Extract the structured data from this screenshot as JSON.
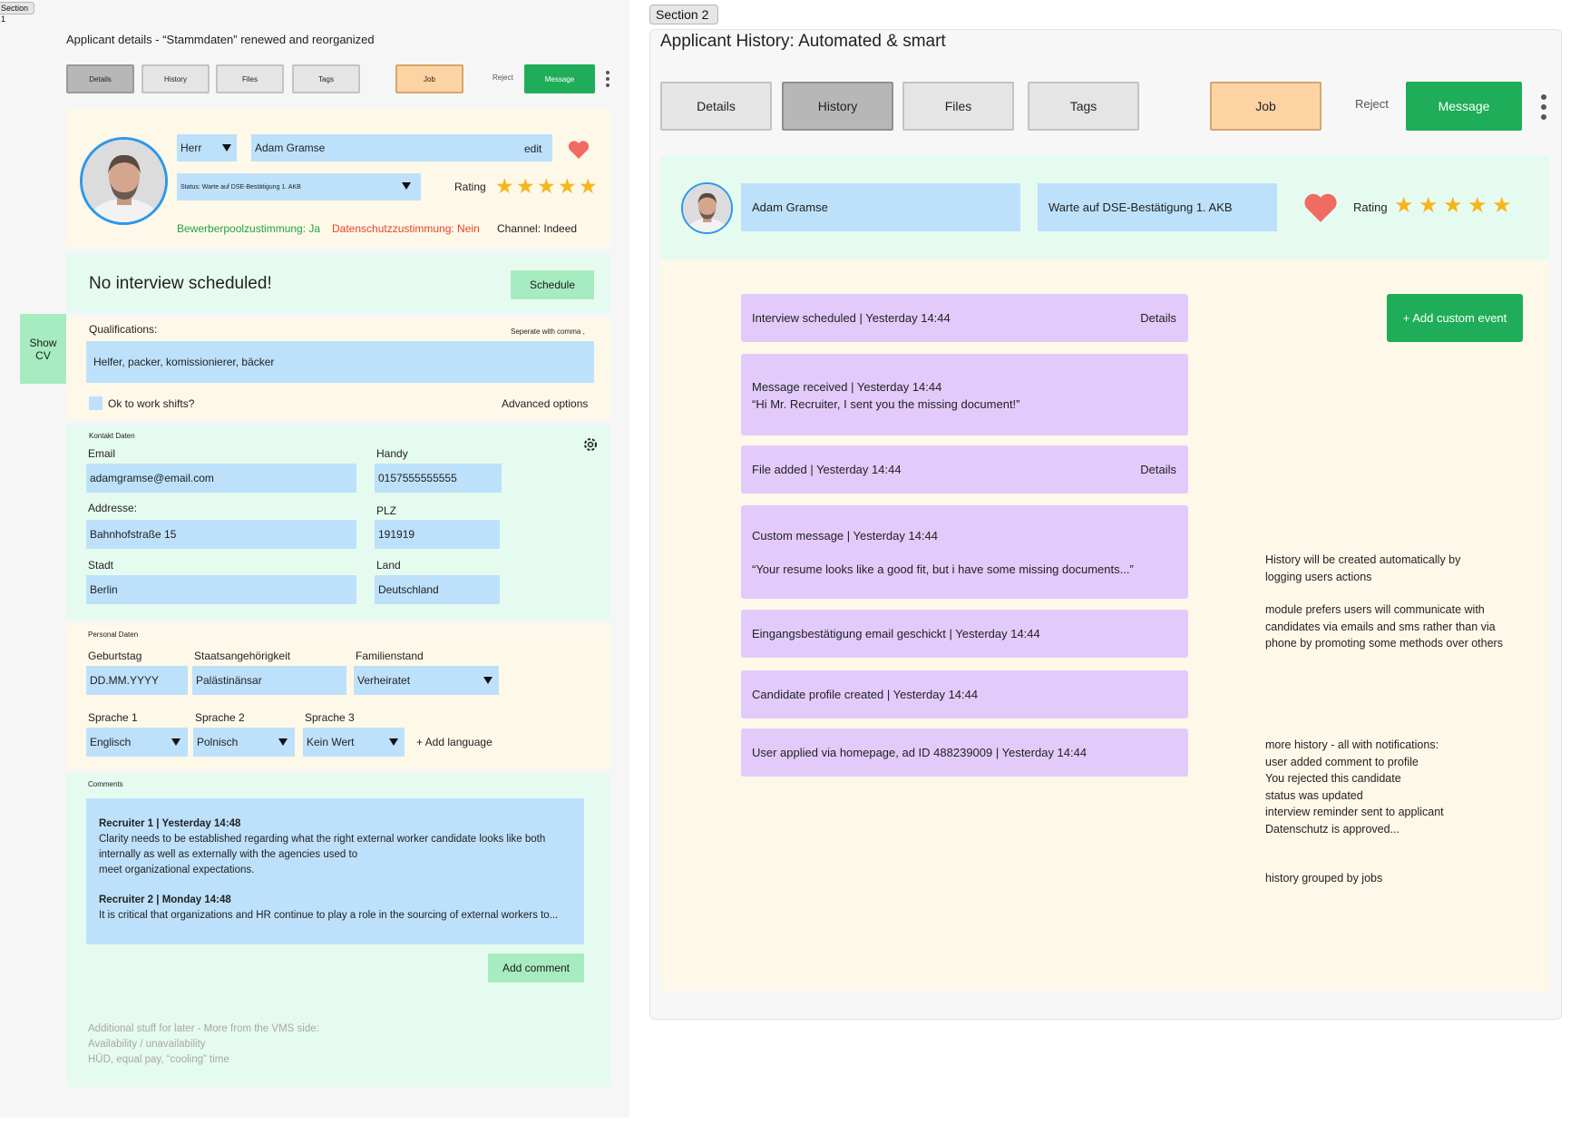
{
  "section1": {
    "tag": "Section 1",
    "title": "Applicant details - “Stammdaten” renewed and reorganized",
    "tabs": {
      "details": "Details",
      "history": "History",
      "files": "Files",
      "tags": "Tags",
      "job": "Job",
      "reject": "Reject",
      "message": "Message"
    },
    "profile": {
      "salutation": "Herr",
      "name": "Adam Gramse",
      "edit": "edit",
      "status": "Status: Warte auf DSE-Bestätigung 1. AKB",
      "rating_label": "Rating",
      "rating": 5,
      "pool_consent": "Bewerberpoolzustimmung: Ja",
      "privacy_consent": "Datenschutzzustimmung: Nein",
      "channel": "Channel: Indeed"
    },
    "interview": {
      "text": "No interview scheduled!",
      "button": "Schedule"
    },
    "show_cv": {
      "line1": "Show",
      "line2": "CV"
    },
    "qualifications": {
      "label": "Qualifications:",
      "hint": "Seperate with comma ,",
      "value": "Helfer, packer, komissionierer, bäcker",
      "shifts_label": "Ok to work shifts?",
      "advanced": "Advanced options"
    },
    "contact": {
      "heading": "Kontakt Daten",
      "email_label": "Email",
      "email": "adamgramse@email.com",
      "phone_label": "Handy",
      "phone": "0157555555555",
      "address_label": "Addresse:",
      "address": "Bahnhofstraße 15",
      "zip_label": "PLZ",
      "zip": "191919",
      "city_label": "Stadt",
      "city": "Berlin",
      "country_label": "Land",
      "country": "Deutschland"
    },
    "personal": {
      "heading": "Personal Daten",
      "birthday_label": "Geburtstag",
      "birthday": "DD.MM.YYYY",
      "nationality_label": "Staatsangehörigkeit",
      "nationality": "Palästinänsar",
      "marital_label": "Familienstand",
      "marital": "Verheiratet",
      "lang1_label": "Sprache 1",
      "lang1": "Englisch",
      "lang2_label": "Sprache 2",
      "lang2": "Polnisch",
      "lang3_label": "Sprache 3",
      "lang3": "Kein Wert",
      "add_language": "+ Add language"
    },
    "comments": {
      "heading": "Comments",
      "c1_author": "Recruiter 1 |  Yesterday 14:48",
      "c1_line1": "Clarity needs to be established regarding what the right external worker candidate looks like both",
      "c1_line2": "internally as well as externally with the agencies used to",
      "c1_line3": "meet organizational expectations.",
      "c2_author": "Recruiter 2 |  Monday 14:48",
      "c2_line1": "It is critical that organizations and HR continue to play a role in the sourcing of external workers to...",
      "add_button": "Add comment"
    },
    "later": {
      "line1": "Additional stuff for later - More from the VMS side:",
      "line2": "Availability / unavailability",
      "line3": "HÜD, equal pay, “cooling” time"
    }
  },
  "section2": {
    "tag": "Section 2",
    "title": "Applicant History: Automated & smart",
    "tabs": {
      "details": "Details",
      "history": "History",
      "files": "Files",
      "tags": "Tags",
      "job": "Job",
      "reject": "Reject",
      "message": "Message"
    },
    "profile": {
      "name": "Adam Gramse",
      "status": "Warte auf DSE-Bestätigung 1. AKB",
      "rating_label": "Rating",
      "rating": 5
    },
    "add_event": "+ Add custom event",
    "events": {
      "e1": {
        "title": "Interview scheduled | Yesterday 14:44",
        "details": "Details"
      },
      "e2": {
        "title": "Message received | Yesterday 14:44",
        "body": "“Hi Mr. Recruiter, I sent you the missing document!”"
      },
      "e3": {
        "title": "File added | Yesterday 14:44",
        "details": "Details"
      },
      "e4": {
        "title": "Custom message | Yesterday 14:44",
        "body": "“Your resume looks like a good fit, but i have some missing documents...”"
      },
      "e5": {
        "title": "Eingangsbestätigung email geschickt | Yesterday 14:44"
      },
      "e6": {
        "title": "Candidate profile created | Yesterday 14:44"
      },
      "e7": {
        "title": "User applied via homepage, ad ID 488239009 | Yesterday 14:44"
      }
    },
    "notes": {
      "n1a": "History will be created automatically by",
      "n1b": "logging users actions",
      "n2a": "module prefers users will communicate with",
      "n2b": "candidates via emails and sms rather than via",
      "n2c": "phone by promoting some methods over others",
      "n3a": "more history - all with notifications:",
      "n3b": "user added comment to profile",
      "n3c": "You rejected this candidate",
      "n3d": "status was updated",
      "n3e": "interview reminder sent to applicant",
      "n3f": "Datenschutz is approved...",
      "n4": "history grouped by jobs"
    }
  },
  "colors": {
    "accent_green": "#1fad59",
    "field_blue": "#bde1fb",
    "event_purple": "#e2cbfb",
    "job_orange": "#fed3a4",
    "consent_yes": "#22a447",
    "consent_no": "#e8432c",
    "star": "#f5b51c"
  },
  "icons": [
    "heart-icon",
    "star-icon",
    "gear-icon",
    "caret-down-icon",
    "kebab-menu-icon",
    "avatar-photo"
  ]
}
